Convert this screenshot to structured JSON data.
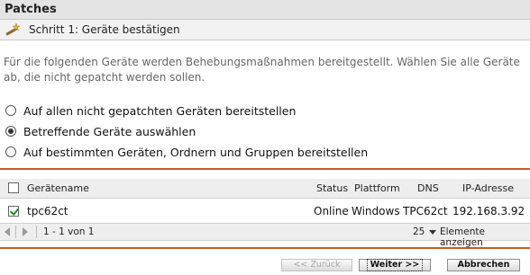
{
  "window": {
    "title": "Patches"
  },
  "step": {
    "title": "Schritt 1: Geräte bestätigen",
    "icon": "wizard-wand-icon"
  },
  "description": "Für die folgenden Geräte werden Behebungsmaßnahmen bereitgestellt. Wählen Sie alle Geräte ab, die nicht gepatcht werden sollen.",
  "options": [
    {
      "label": "Auf allen nicht gepatchten Geräten bereitstellen",
      "selected": false
    },
    {
      "label": "Betreffende Geräte auswählen",
      "selected": true
    },
    {
      "label": "Auf bestimmten Geräten, Ordnern und Gruppen bereitstellen",
      "selected": false
    }
  ],
  "table": {
    "columns": [
      "Gerätename",
      "Status",
      "Plattform",
      "DNS",
      "IP-Adresse"
    ],
    "rows": [
      {
        "checked": true,
        "name": "tpc62ct",
        "status": "Online",
        "platform": "Windows",
        "dns": "TPC62ct",
        "ip": "192.168.3.92"
      }
    ]
  },
  "pager": {
    "range": "1 - 1 von 1",
    "page_size": "25",
    "page_size_label": "Elemente anzeigen"
  },
  "buttons": {
    "back": "<< Zurück",
    "next": "Weiter >>",
    "cancel": "Abbrechen"
  },
  "colors": {
    "accent_rule": "#cf5a1f",
    "check": "#1c8a1c"
  }
}
